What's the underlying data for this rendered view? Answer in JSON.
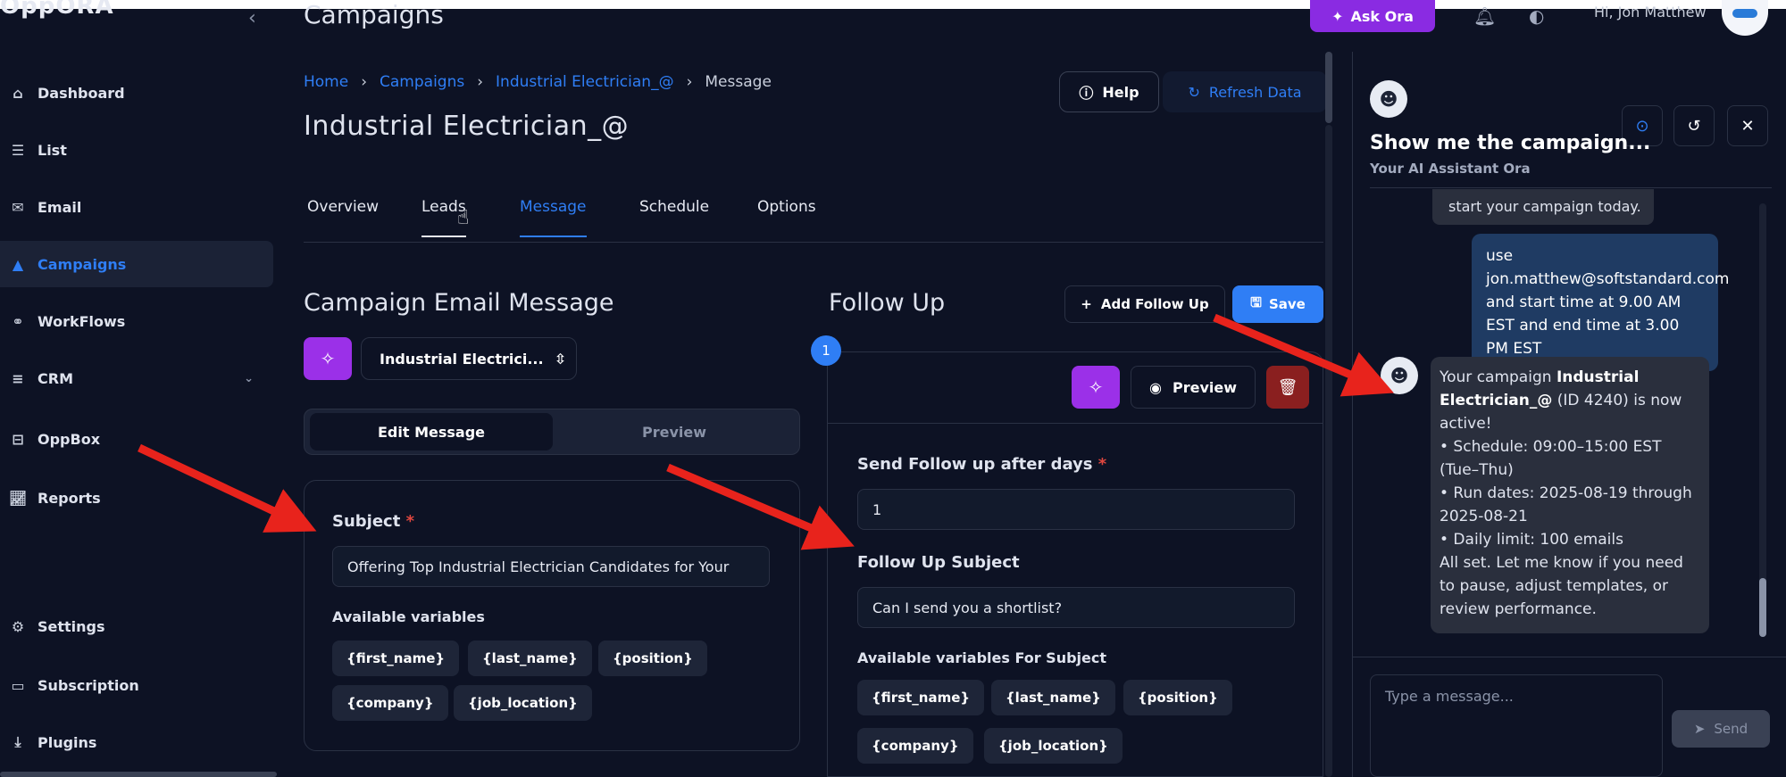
{
  "brand": {
    "logo_text": "OppORA"
  },
  "topbar": {
    "page_title": "Campaigns",
    "ask_label": "Ask Ora",
    "greeting": "Hi, Jon Matthew"
  },
  "sidebar": {
    "items": [
      {
        "label": "Dashboard",
        "icon": "home-icon"
      },
      {
        "label": "List",
        "icon": "list-icon"
      },
      {
        "label": "Email",
        "icon": "mail-icon"
      },
      {
        "label": "Campaigns",
        "icon": "campaign-icon",
        "active": true
      },
      {
        "label": "WorkFlows",
        "icon": "workflow-icon"
      },
      {
        "label": "CRM",
        "icon": "crm-icon"
      },
      {
        "label": "OppBox",
        "icon": "inbox-icon"
      },
      {
        "label": "Reports",
        "icon": "reports-icon"
      },
      {
        "label": "Settings",
        "icon": "gear-icon"
      },
      {
        "label": "Subscription",
        "icon": "card-icon"
      },
      {
        "label": "Plugins",
        "icon": "plugin-icon"
      }
    ]
  },
  "header": {
    "breadcrumb": [
      "Home",
      "Campaigns",
      "Industrial Electrician_@",
      "Message"
    ],
    "campaign_title": "Industrial Electrician_@",
    "help_label": "Help",
    "refresh_label": "Refresh Data"
  },
  "tabs": [
    "Overview",
    "Leads",
    "Message",
    "Schedule",
    "Options"
  ],
  "message": {
    "title": "Campaign Email Message",
    "template_select": "Industrial Electrici...",
    "edit_label": "Edit Message",
    "preview_label": "Preview",
    "subject_label": "Subject",
    "subject_value": "Offering Top Industrial Electrician Candidates for Your",
    "variables_label": "Available variables",
    "variables": [
      "{first_name}",
      "{last_name}",
      "{position}",
      "{company}",
      "{job_location}"
    ]
  },
  "followup": {
    "title": "Follow Up",
    "add_label": "Add Follow Up",
    "save_label": "Save",
    "step": "1",
    "preview_label": "Preview",
    "days_label": "Send Follow up after days",
    "days_value": "1",
    "subject_label": "Follow Up Subject",
    "subject_value": "Can I send you a shortlist?",
    "variables_label": "Available variables For Subject",
    "variables": [
      "{first_name}",
      "{last_name}",
      "{position}",
      "{company}",
      "{job_location}"
    ]
  },
  "assistant": {
    "title": "Show me the campaign...",
    "subtitle": "Your AI Assistant Ora",
    "cut_message": "start your campaign today.",
    "user_message": "use jon.matthew@softstandard.com and start time at 9.00 AM EST and end time at 3.00 PM EST",
    "bot_intro": "Your campaign",
    "bot_campaign": "Industrial Electrician_@",
    "bot_status": "(ID 4240) is now active!",
    "bot_schedule": "• Schedule: 09:00–15:00 EST (Tue–Thu)",
    "bot_dates": "• Run dates: 2025-08-19 through 2025-08-21",
    "bot_limit": "• Daily limit: 100 emails",
    "bot_closing": "All set. Let me know if you need to pause, adjust templates, or review performance.",
    "input_placeholder": "Type a message...",
    "send_label": "Send"
  },
  "colors": {
    "accent": "#2f7ef5",
    "magic": "#9b30e8",
    "danger": "#8a1f1f",
    "annotation": "#e8231c"
  }
}
